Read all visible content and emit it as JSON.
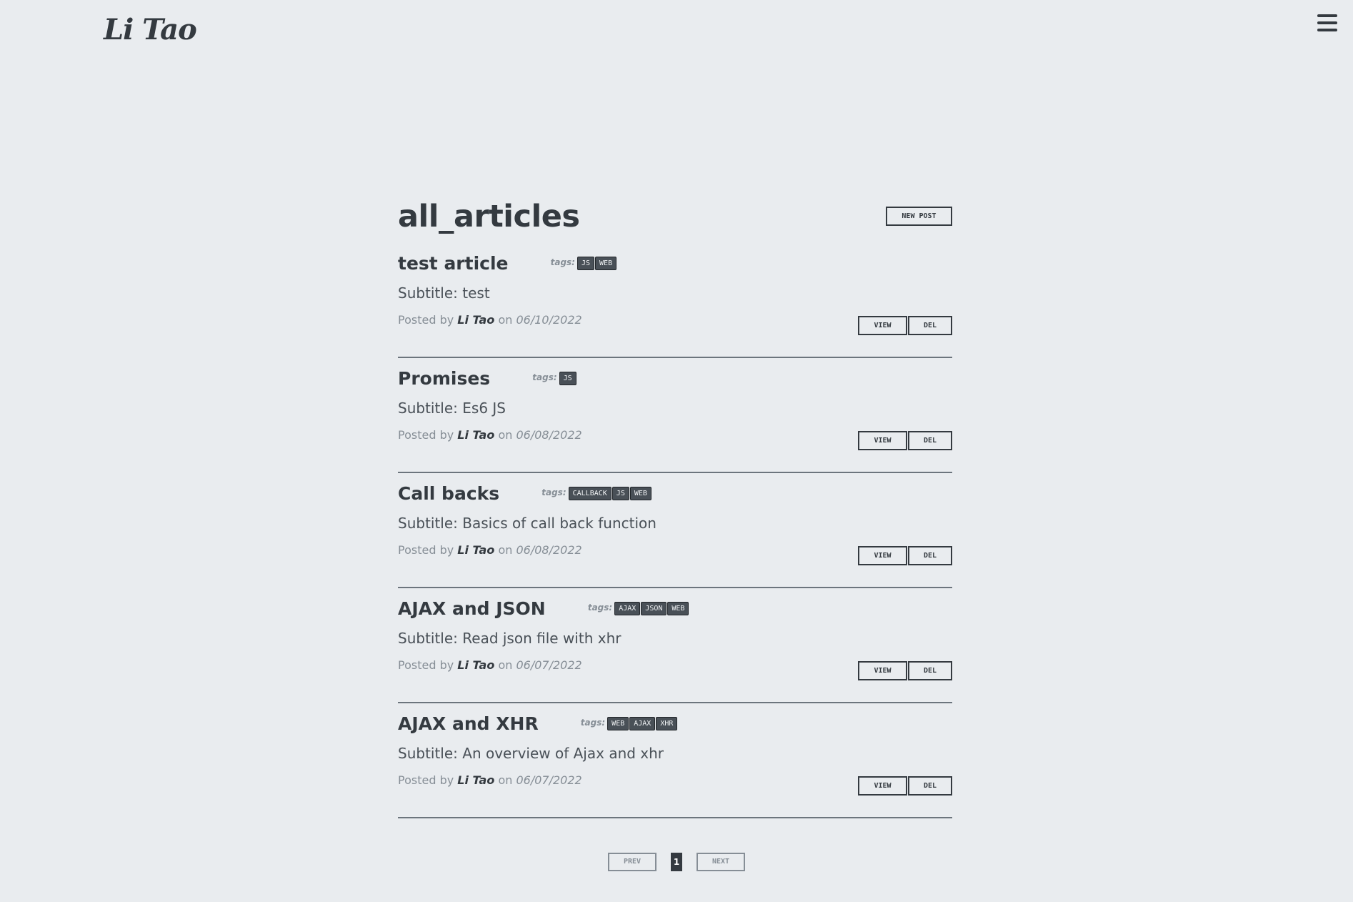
{
  "header": {
    "logo": "Li Tao",
    "menu_icon": "hamburger-menu-icon"
  },
  "page": {
    "title": "all_articles",
    "new_post_label": "new post"
  },
  "labels": {
    "tags_label": "tags:",
    "posted_by": "Posted by",
    "on": "on",
    "view": "view",
    "del": "del"
  },
  "articles": [
    {
      "title": "test article",
      "tags": [
        "JS",
        "WEB"
      ],
      "subtitle": "Subtitle: test",
      "author": "Li Tao",
      "date": "06/10/2022"
    },
    {
      "title": "Promises",
      "tags": [
        "JS"
      ],
      "subtitle": "Subtitle: Es6 JS",
      "author": "Li Tao",
      "date": "06/08/2022"
    },
    {
      "title": "Call backs",
      "tags": [
        "CALLBACK",
        "JS",
        "WEB"
      ],
      "subtitle": "Subtitle: Basics of call back function",
      "author": "Li Tao",
      "date": "06/08/2022"
    },
    {
      "title": "AJAX and JSON",
      "tags": [
        "AJAX",
        "JSON",
        "WEB"
      ],
      "subtitle": "Subtitle: Read json file with xhr",
      "author": "Li Tao",
      "date": "06/07/2022"
    },
    {
      "title": "AJAX and XHR",
      "tags": [
        "WEB",
        "AJAX",
        "XHR"
      ],
      "subtitle": "Subtitle: An overview of Ajax and xhr",
      "author": "Li Tao",
      "date": "06/07/2022"
    }
  ],
  "pagination": {
    "prev_label": "prev",
    "current_page": "1",
    "next_label": "next"
  }
}
